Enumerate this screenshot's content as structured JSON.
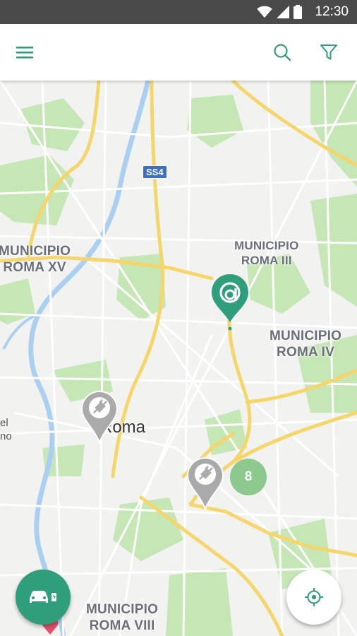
{
  "status_bar": {
    "time": "12:30",
    "icons": [
      "wifi-icon",
      "signal-icon",
      "battery-icon"
    ]
  },
  "app_bar": {
    "icons": [
      "menu-icon",
      "search-icon",
      "filter-icon"
    ],
    "accent": "#2e9e7c"
  },
  "map": {
    "labels": {
      "municipio_xv": "MUNICIPIO\nROMA XV",
      "municipio_iii": "MUNICIPIO\nROMA III",
      "municipio_iv": "MUNICIPIO\nROMA IV",
      "municipio_viii": "MUNICIPIO\nROMA VIII",
      "city": "Roma",
      "partial_place": "el\nno",
      "road_shield": "SS4"
    },
    "cluster_count": "8",
    "markers": [
      "brand-marker-a",
      "charging-station-marker",
      "charging-station-marker"
    ]
  },
  "fabs": {
    "vehicle_icon": "car-charging-icon",
    "locate_icon": "my-location-icon"
  },
  "colors": {
    "brand": "#2e9e7c",
    "cluster": "#8cc98e",
    "marker_grey": "#a9aaa9",
    "road": "#f6d66b",
    "park": "#c5e6b5",
    "water": "#a9d0f2"
  }
}
